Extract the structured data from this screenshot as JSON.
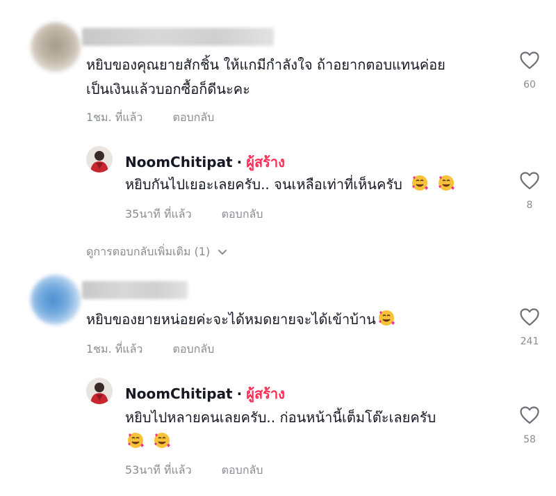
{
  "comments": [
    {
      "text_line1": "หยิบของคุณยายสักชิ้น ให้แกมีกำลังใจ ถ้าอยากตอบแทนค่อย",
      "text_line2": "เป็นเงินแล้วบอกซื้อก็ดีนะคะ",
      "time": "1ชม. ที่แล้ว",
      "reply_label": "ตอบกลับ",
      "likes": "60",
      "reply": {
        "author": "NoomChitipat",
        "separator": "·",
        "badge": "ผู้สร้าง",
        "text": "หยิบกันไปเยอะเลยครับ.. จนเหลือเท่าที่เห็นครับ",
        "time": "35นาที ที่แล้ว",
        "reply_label": "ตอบกลับ",
        "likes": "8"
      },
      "more_replies": "ดูการตอบกลับเพิ่มเติม (1)"
    },
    {
      "text_line1": "หยิบของยายหน่อยค่ะจะได้หมดยายจะได้เข้าบ้าน",
      "time": "1ชม. ที่แล้ว",
      "reply_label": "ตอบกลับ",
      "likes": "241",
      "reply": {
        "author": "NoomChitipat",
        "separator": "·",
        "badge": "ผู้สร้าง",
        "text": "หยิบไปหลายคนเลยครับ.. ก่อนหน้านี้เต็มโต๊ะเลยครับ",
        "time": "53นาที ที่แล้ว",
        "reply_label": "ตอบกลับ",
        "likes": "58"
      }
    }
  ],
  "colors": {
    "text": "#161823",
    "muted": "#8a8b91",
    "creator_badge": "#fe2c55"
  },
  "icons": {
    "like": "heart-outline-icon",
    "emoji": "smiling-face-with-hearts-icon",
    "expand": "chevron-down-icon"
  }
}
